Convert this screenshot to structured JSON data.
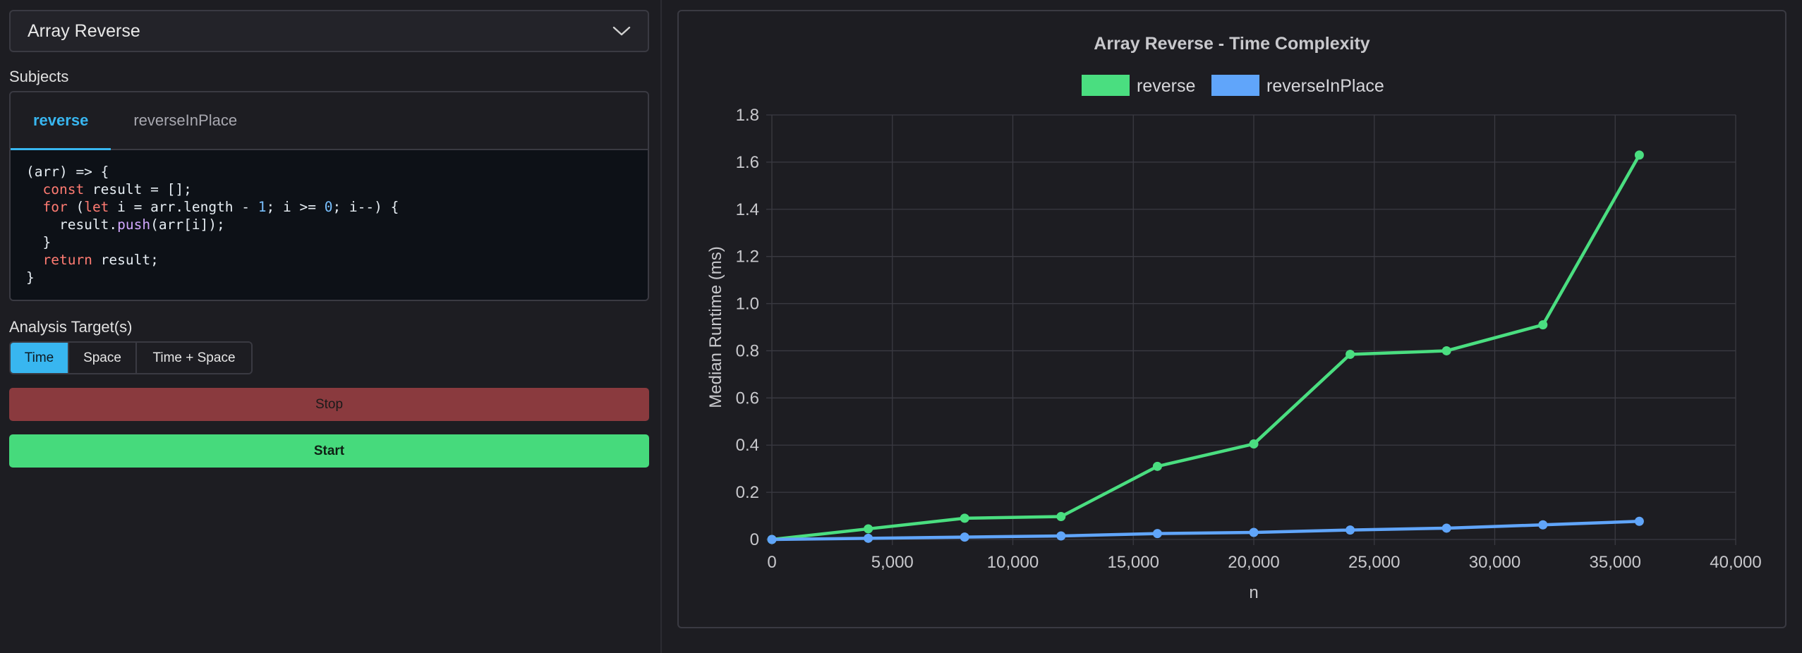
{
  "algorithm_select": {
    "value": "Array Reverse"
  },
  "subjects": {
    "label": "Subjects",
    "tabs": [
      {
        "label": "reverse",
        "active": true
      },
      {
        "label": "reverseInPlace",
        "active": false
      }
    ],
    "code_lines": [
      "(arr) => {",
      "  const result = [];",
      "  for (let i = arr.length - 1; i >= 0; i--) {",
      "    result.push(arr[i]);",
      "  }",
      "  return result;",
      "}"
    ]
  },
  "analysis": {
    "label": "Analysis Target(s)",
    "options": [
      {
        "label": "Time",
        "active": true
      },
      {
        "label": "Space",
        "active": false
      },
      {
        "label": "Time + Space",
        "active": false
      }
    ]
  },
  "buttons": {
    "stop": "Stop",
    "start": "Start"
  },
  "colors": {
    "accent": "#38b6f0",
    "stop": "#8a3a3e",
    "start": "#46da7c",
    "series_reverse": "#4ade80",
    "series_inplace": "#60a5fa"
  },
  "chart_data": {
    "type": "line",
    "title": "Array Reverse - Time Complexity",
    "xlabel": "n",
    "ylabel": "Median Runtime (ms)",
    "xlim": [
      0,
      40000
    ],
    "ylim": [
      0,
      1.8
    ],
    "x_ticks": [
      "0",
      "5,000",
      "10,000",
      "15,000",
      "20,000",
      "25,000",
      "30,000",
      "35,000",
      "40,000"
    ],
    "y_ticks": [
      "0",
      "0.2",
      "0.4",
      "0.6",
      "0.8",
      "1.0",
      "1.2",
      "1.4",
      "1.6",
      "1.8"
    ],
    "grid": true,
    "legend_position": "top",
    "x": [
      0,
      4000,
      8000,
      12000,
      16000,
      20000,
      24000,
      28000,
      32000,
      36000
    ],
    "series": [
      {
        "name": "reverse",
        "color": "#4ade80",
        "values": [
          0.0,
          0.045,
          0.09,
          0.097,
          0.31,
          0.405,
          0.785,
          0.8,
          0.91,
          1.63
        ]
      },
      {
        "name": "reverseInPlace",
        "color": "#60a5fa",
        "values": [
          0.0,
          0.005,
          0.01,
          0.015,
          0.025,
          0.03,
          0.04,
          0.048,
          0.062,
          0.077
        ]
      }
    ]
  }
}
